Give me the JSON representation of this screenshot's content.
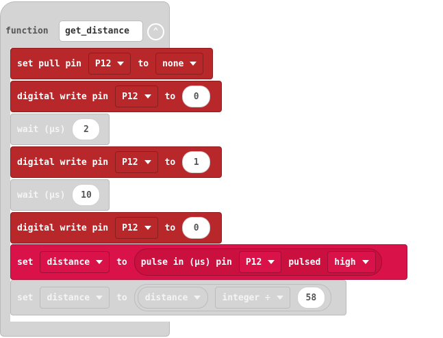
{
  "function_def": {
    "keyword": "function",
    "name": "get_distance",
    "collapse_icon": "chevron-up-icon"
  },
  "blocks": {
    "set_pull": {
      "label": "set pull pin",
      "pin": "P12",
      "to": "to",
      "mode": "none"
    },
    "write1": {
      "label": "digital write pin",
      "pin": "P12",
      "to": "to",
      "value": "0"
    },
    "wait1": {
      "label": "wait (µs)",
      "value": "2"
    },
    "write2": {
      "label": "digital write pin",
      "pin": "P12",
      "to": "to",
      "value": "1"
    },
    "wait2": {
      "label": "wait (µs)",
      "value": "10"
    },
    "write3": {
      "label": "digital write pin",
      "pin": "P12",
      "to": "to",
      "value": "0"
    },
    "set_distance": {
      "label": "set",
      "variable": "distance",
      "to": "to",
      "reporter": {
        "label": "pulse in (µs) pin",
        "pin": "P12",
        "pulsed": "pulsed",
        "level": "high"
      }
    },
    "set_distance2": {
      "label": "set",
      "variable": "distance",
      "to": "to",
      "reporter": {
        "left": "distance",
        "operator": "integer ÷",
        "right": "58"
      }
    }
  },
  "colors": {
    "pins_block": "#b8282a",
    "variables_block": "#d9134a",
    "disabled_block": "#d4d4d4"
  }
}
